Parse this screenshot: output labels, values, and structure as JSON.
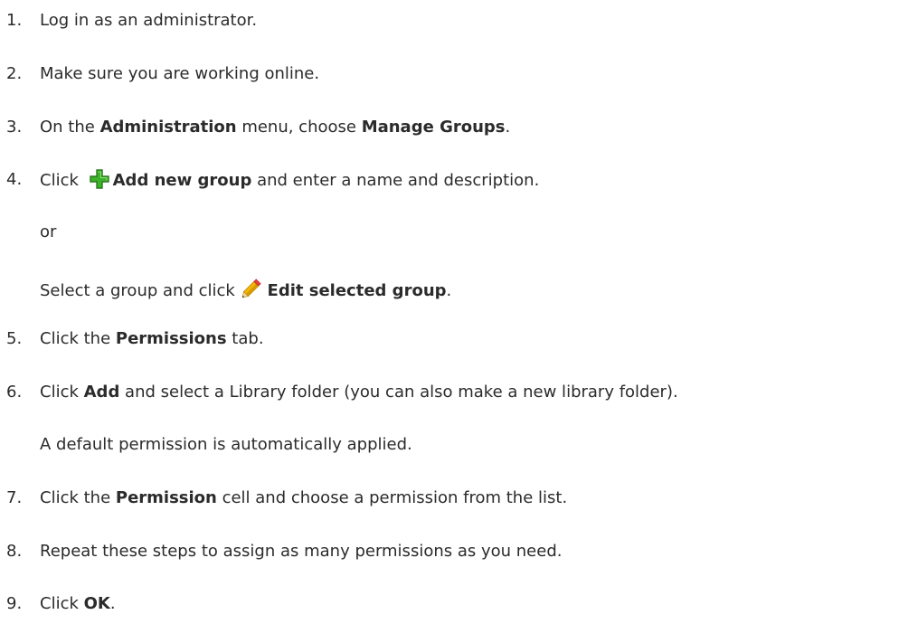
{
  "steps": [
    {
      "num": "1.",
      "pre": "Log in as an administrator."
    },
    {
      "num": "2.",
      "pre": "Make sure you are working online."
    },
    {
      "num": "3.",
      "pre": "On the ",
      "b1": "Administration",
      "mid": " menu, choose ",
      "b2": "Manage Groups",
      "post": "."
    },
    {
      "num": "4.",
      "pre": "Click ",
      "icon": "green-plus-icon",
      "b1": "Add new group",
      "post": " and enter a name and description."
    },
    {
      "num": "5.",
      "pre": "Click the ",
      "b1": "Permissions",
      "post": " tab."
    },
    {
      "num": "6.",
      "pre": "Click ",
      "b1": "Add",
      "post": " and select a Library folder (you can also make a new library folder)."
    },
    {
      "num": "7.",
      "pre": "Click the ",
      "b1": "Permission",
      "post": " cell and choose a permission from the list."
    },
    {
      "num": "8.",
      "pre": "Repeat these steps to assign as many permissions as you need."
    },
    {
      "num": "9.",
      "pre": "Click ",
      "b1": "OK",
      "post": "."
    }
  ],
  "step4_or": "or",
  "step4_alt": {
    "pre": "Select a group and click ",
    "icon": "pencil-icon",
    "b1": "Edit selected group",
    "post": "."
  },
  "step6_note": "A default permission is automatically applied.",
  "icon_colors": {
    "plus": "#3cb32a",
    "plus_outline": "#2a7a1c",
    "pencil_body": "#f2b705",
    "pencil_tip": "#e8403a"
  }
}
